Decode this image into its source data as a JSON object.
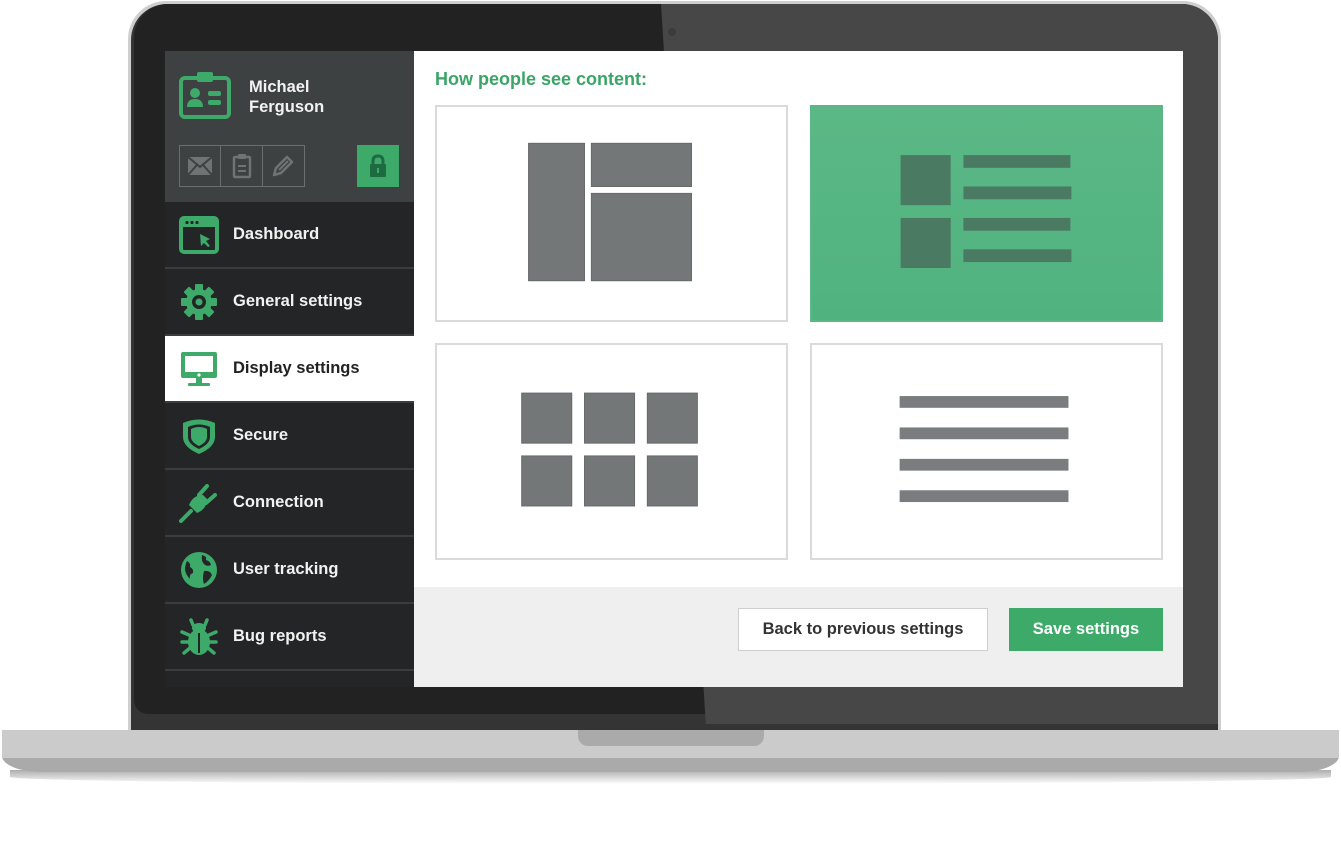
{
  "user": {
    "name_line1": "Michael",
    "name_line2": "Ferguson"
  },
  "profile_tools": [
    {
      "name": "mail",
      "icon": "envelope-icon"
    },
    {
      "name": "notes",
      "icon": "clipboard-icon"
    },
    {
      "name": "edit",
      "icon": "pencil-icon"
    }
  ],
  "lock": {
    "icon": "lock-icon",
    "state": "locked"
  },
  "sidebar": {
    "items": [
      {
        "label": "Dashboard",
        "icon": "browser-cursor-icon",
        "active": false
      },
      {
        "label": "General settings",
        "icon": "gear-icon",
        "active": false
      },
      {
        "label": "Display settings",
        "icon": "monitor-icon",
        "active": true
      },
      {
        "label": "Secure",
        "icon": "shield-icon",
        "active": false
      },
      {
        "label": "Connection",
        "icon": "plug-icon",
        "active": false
      },
      {
        "label": "User tracking",
        "icon": "globe-icon",
        "active": false
      },
      {
        "label": "Bug reports",
        "icon": "bug-icon",
        "active": false
      }
    ]
  },
  "main": {
    "heading": "How people see content:",
    "layout_options": [
      {
        "name": "masonry",
        "selected": false
      },
      {
        "name": "list-with-thumbnails",
        "selected": true
      },
      {
        "name": "grid",
        "selected": false
      },
      {
        "name": "text-list",
        "selected": false
      }
    ]
  },
  "footer": {
    "back_label": "Back to previous settings",
    "save_label": "Save settings"
  },
  "colors": {
    "accent": "#3daa6a",
    "selected_card": "#56b683",
    "sidebar_bg": "#242526",
    "profile_bg": "#3d4142"
  }
}
